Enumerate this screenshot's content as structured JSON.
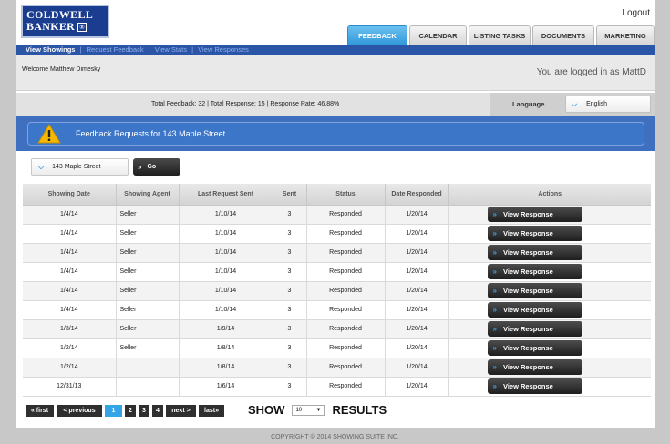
{
  "header": {
    "logo_line1": "COLDWELL",
    "logo_line2": "BANKER",
    "logo_mark": "®",
    "logout": "Logout",
    "tabs": [
      {
        "label": "FEEDBACK",
        "active": true
      },
      {
        "label": "CALENDAR"
      },
      {
        "label": "LISTING TASKS"
      },
      {
        "label": "DOCUMENTS"
      },
      {
        "label": "MARKETING"
      }
    ]
  },
  "subnav": {
    "items": [
      "View Showings",
      "Request Feedback",
      "View Stats",
      "View Responses"
    ],
    "separator": "|"
  },
  "welcome": {
    "message": "Welcome Matthew Dimesky",
    "logged_in": "You are logged in as MattD"
  },
  "stats": {
    "summary": "Total Feedback: 32 | Total Response: 15 | Response Rate: 46.88%"
  },
  "language": {
    "label": "Language",
    "selected": "English"
  },
  "alert": {
    "title": "Feedback Requests for 143 Maple Street"
  },
  "filter": {
    "property": "143 Maple Street",
    "go_label": "Go"
  },
  "table": {
    "columns": [
      "Showing Date",
      "Showing Agent",
      "Last Request Sent",
      "Sent",
      "Status",
      "Date Responded",
      "Actions"
    ],
    "action_label": "View Response",
    "rows": [
      [
        "1/4/14",
        "Seller",
        "1/10/14",
        "3",
        "Responded",
        "1/20/14"
      ],
      [
        "1/4/14",
        "Seller",
        "1/10/14",
        "3",
        "Responded",
        "1/20/14"
      ],
      [
        "1/4/14",
        "Seller",
        "1/10/14",
        "3",
        "Responded",
        "1/20/14"
      ],
      [
        "1/4/14",
        "Seller",
        "1/10/14",
        "3",
        "Responded",
        "1/20/14"
      ],
      [
        "1/4/14",
        "Seller",
        "1/10/14",
        "3",
        "Responded",
        "1/20/14"
      ],
      [
        "1/4/14",
        "Seller",
        "1/10/14",
        "3",
        "Responded",
        "1/20/14"
      ],
      [
        "1/3/14",
        "Seller",
        "1/9/14",
        "3",
        "Responded",
        "1/20/14"
      ],
      [
        "1/2/14",
        "Seller",
        "1/8/14",
        "3",
        "Responded",
        "1/20/14"
      ],
      [
        "1/2/14",
        "",
        "1/8/14",
        "3",
        "Responded",
        "1/20/14"
      ],
      [
        "12/31/13",
        "",
        "1/6/14",
        "3",
        "Responded",
        "1/20/14"
      ]
    ]
  },
  "pagination": {
    "first": "« first",
    "previous": "< previous",
    "pages": [
      "1",
      "2",
      "3",
      "4"
    ],
    "current": "1",
    "next": "next >",
    "last": "last»",
    "show_label": "SHOW",
    "results_label": "RESULTS",
    "per_page": "10"
  },
  "footer": {
    "copyright": "COPYRIGHT © 2014 SHOWING SUITE INC."
  },
  "colors": {
    "brand_blue": "#1b3d8f",
    "nav_blue": "#2b56a8",
    "active_tab": "#2f97d9",
    "alert_blue": "#3c76c9",
    "button_dark": "#1e1e1e"
  },
  "icons": {
    "alert": "warning-icon",
    "dropdown": "chevron-down-icon",
    "button": "double-chevron-right-icon"
  }
}
